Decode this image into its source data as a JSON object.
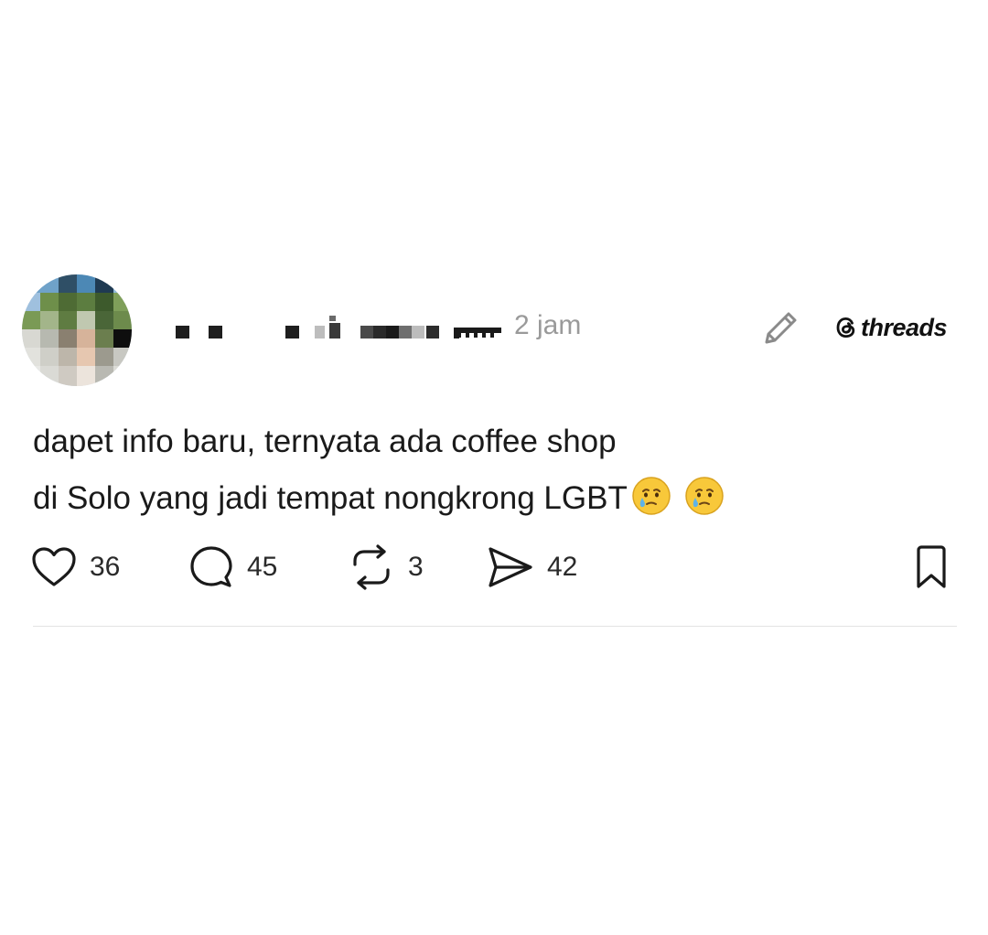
{
  "post": {
    "timestamp": "2 jam",
    "text_line_1": "dapet info baru, ternyata ada coffee shop",
    "text_line_2": "di Solo yang jadi tempat nongkrong LGBT",
    "emojis": [
      "crying-face-emoji",
      "crying-face-emoji"
    ]
  },
  "brand": {
    "name": "threads"
  },
  "actions": {
    "likes": "36",
    "replies": "45",
    "reposts": "3",
    "shares": "42"
  },
  "icons": {
    "edit": "pencil-icon",
    "like": "heart-icon",
    "reply": "comment-icon",
    "repost": "repost-icon",
    "share": "send-icon",
    "bookmark": "bookmark-icon",
    "brand_logo": "threads-logo-icon"
  },
  "colors": {
    "text": "#1a1a1a",
    "muted": "#9a9a9a",
    "divider": "#e3e3e3",
    "background": "#ffffff"
  }
}
